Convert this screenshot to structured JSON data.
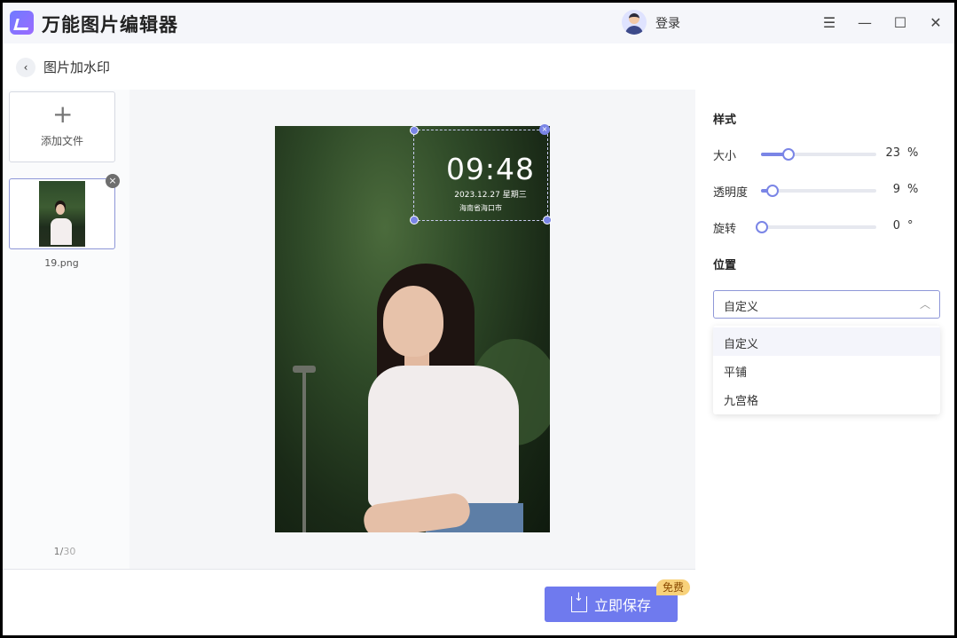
{
  "app": {
    "title": "万能图片编辑器",
    "login_label": "登录"
  },
  "window_controls": {
    "menu": "☰",
    "minimize": "—",
    "maximize": "☐",
    "close": "✕"
  },
  "header": {
    "back_icon": "‹",
    "title": "图片加水印"
  },
  "sidebar": {
    "add_file_label": "添加文件",
    "add_icon": "+",
    "thumb_close": "×",
    "file_name": "19.png",
    "page_current": "1/",
    "page_total": "30"
  },
  "watermark": {
    "time": "09:48",
    "date": "2023.12.27  星期三",
    "place": "海南省海口市",
    "close": "×"
  },
  "save": {
    "label": "立即保存",
    "badge": "免费"
  },
  "style_panel": {
    "title": "样式",
    "size": {
      "label": "大小",
      "value": "23",
      "unit": "%",
      "fraction": 0.23
    },
    "opacity": {
      "label": "透明度",
      "value": "9",
      "unit": "%",
      "fraction": 0.09
    },
    "rotate": {
      "label": "旋转",
      "value": "0",
      "unit": "°",
      "fraction": 0.0
    }
  },
  "position_panel": {
    "title": "位置",
    "selected": "自定义",
    "chevron": "︿",
    "options": [
      "自定义",
      "平铺",
      "九宫格"
    ]
  },
  "colors": {
    "accent": "#7a85e6",
    "button": "#6f7aee",
    "badge": "#f8d27b"
  }
}
